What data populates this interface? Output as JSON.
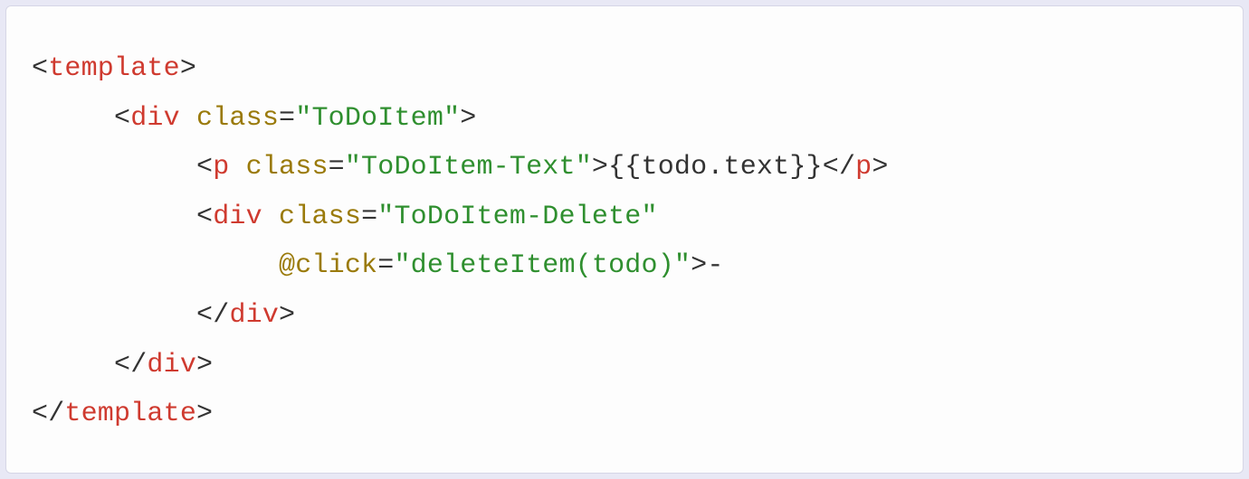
{
  "code": {
    "lines": [
      {
        "indent": 0,
        "tokens": [
          {
            "cls": "punct",
            "t": "<"
          },
          {
            "cls": "tag",
            "t": "template"
          },
          {
            "cls": "punct",
            "t": ">"
          }
        ]
      },
      {
        "indent": 1,
        "tokens": [
          {
            "cls": "punct",
            "t": "<"
          },
          {
            "cls": "tag",
            "t": "div"
          },
          {
            "cls": "punct",
            "t": " "
          },
          {
            "cls": "attr",
            "t": "class"
          },
          {
            "cls": "punct",
            "t": "="
          },
          {
            "cls": "string",
            "t": "\"ToDoItem\""
          },
          {
            "cls": "punct",
            "t": ">"
          }
        ]
      },
      {
        "indent": 2,
        "tokens": [
          {
            "cls": "punct",
            "t": "<"
          },
          {
            "cls": "tag",
            "t": "p"
          },
          {
            "cls": "punct",
            "t": " "
          },
          {
            "cls": "attr",
            "t": "class"
          },
          {
            "cls": "punct",
            "t": "="
          },
          {
            "cls": "string",
            "t": "\"ToDoItem-Text\""
          },
          {
            "cls": "punct",
            "t": ">"
          },
          {
            "cls": "text",
            "t": "{{todo.text}}"
          },
          {
            "cls": "punct",
            "t": "</"
          },
          {
            "cls": "tag",
            "t": "p"
          },
          {
            "cls": "punct",
            "t": ">"
          }
        ]
      },
      {
        "indent": 2,
        "tokens": [
          {
            "cls": "punct",
            "t": "<"
          },
          {
            "cls": "tag",
            "t": "div"
          },
          {
            "cls": "punct",
            "t": " "
          },
          {
            "cls": "attr",
            "t": "class"
          },
          {
            "cls": "punct",
            "t": "="
          },
          {
            "cls": "string",
            "t": "\"ToDoItem-Delete\""
          }
        ]
      },
      {
        "indent": 3,
        "tokens": [
          {
            "cls": "attr",
            "t": "@click"
          },
          {
            "cls": "punct",
            "t": "="
          },
          {
            "cls": "string",
            "t": "\"deleteItem(todo)\""
          },
          {
            "cls": "punct",
            "t": ">"
          },
          {
            "cls": "text",
            "t": "-"
          }
        ]
      },
      {
        "indent": 2,
        "tokens": [
          {
            "cls": "punct",
            "t": "</"
          },
          {
            "cls": "tag",
            "t": "div"
          },
          {
            "cls": "punct",
            "t": ">"
          }
        ]
      },
      {
        "indent": 1,
        "tokens": [
          {
            "cls": "punct",
            "t": "</"
          },
          {
            "cls": "tag",
            "t": "div"
          },
          {
            "cls": "punct",
            "t": ">"
          }
        ]
      },
      {
        "indent": 0,
        "tokens": [
          {
            "cls": "punct",
            "t": "</"
          },
          {
            "cls": "tag",
            "t": "template"
          },
          {
            "cls": "punct",
            "t": ">"
          }
        ]
      }
    ],
    "indent_unit": "     "
  }
}
